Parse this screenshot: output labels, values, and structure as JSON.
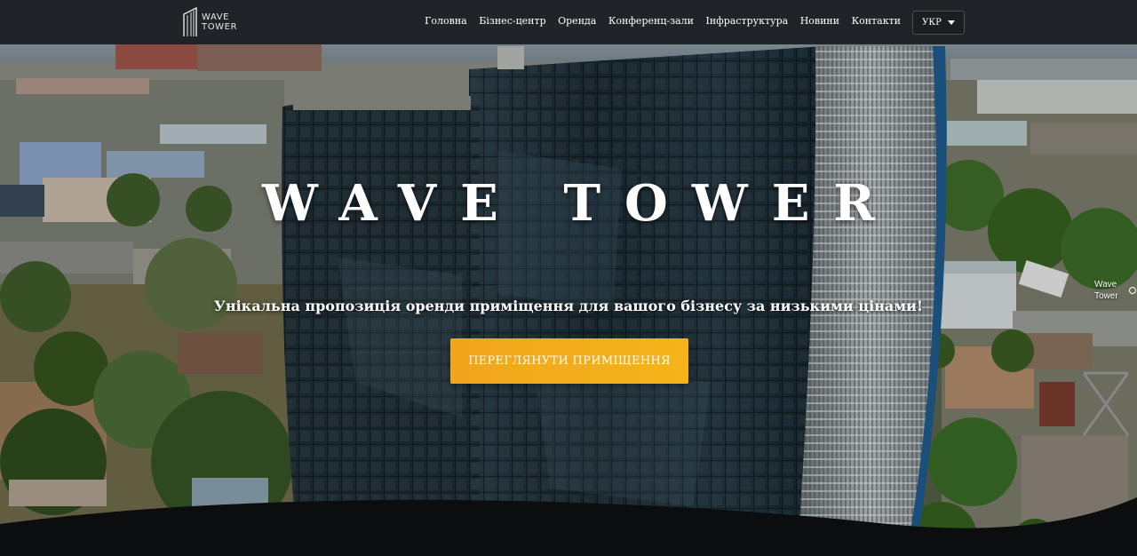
{
  "header": {
    "logo_line1": "WAVE",
    "logo_line2": "TOWER",
    "nav": [
      {
        "label": "Головна"
      },
      {
        "label": "Бізнес-центр"
      },
      {
        "label": "Оренда"
      },
      {
        "label": "Конференц-зали"
      },
      {
        "label": "Інфраструктура"
      },
      {
        "label": "Новини"
      },
      {
        "label": "Контакти"
      }
    ],
    "language": "УКР"
  },
  "hero": {
    "title": "WAVE TOWER",
    "subtitle": "Унікальна пропозиція оренди приміщення для вашого бізнесу за низькими цінами!",
    "cta_label": "ПЕРЕГЛЯНУТИ ПРИМІЩЕННЯ",
    "side_caption": "Wave Tower"
  },
  "colors": {
    "header_bg": "#202328",
    "cta": "#f4b41a",
    "glass": "#1c2a33"
  },
  "icons": {
    "logo": "tower-logo-icon",
    "language_caret": "chevron-down-icon"
  }
}
